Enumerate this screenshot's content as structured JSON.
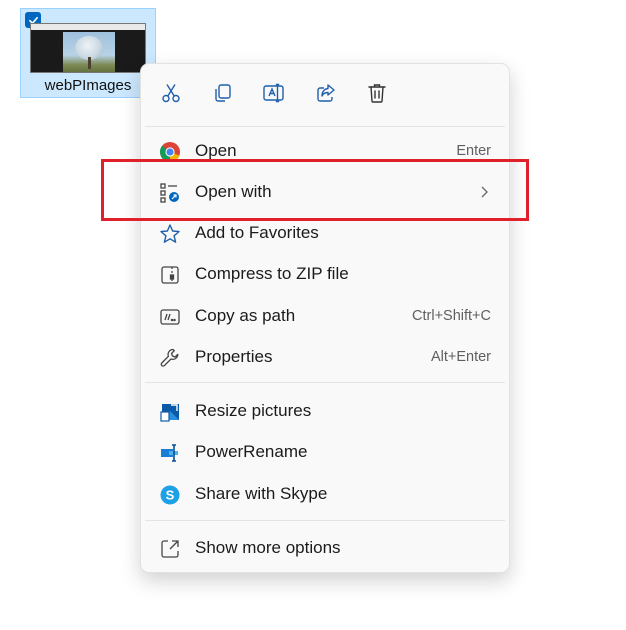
{
  "file": {
    "name": "webPImages",
    "selected": true
  },
  "toolbar": {
    "buttons": [
      {
        "id": "cut",
        "icon": "scissors-icon",
        "tooltip": "Cut"
      },
      {
        "id": "copy",
        "icon": "copy-icon",
        "tooltip": "Copy"
      },
      {
        "id": "rename",
        "icon": "rename-icon",
        "tooltip": "Rename"
      },
      {
        "id": "share",
        "icon": "share-icon",
        "tooltip": "Share"
      },
      {
        "id": "delete",
        "icon": "trash-icon",
        "tooltip": "Delete"
      }
    ]
  },
  "menu": {
    "items": [
      {
        "label": "Open",
        "shortcut": "Enter",
        "icon": "chrome-icon"
      },
      {
        "label": "Open with",
        "shortcut": "",
        "icon": "open-with-icon",
        "submenu": true,
        "highlighted": true
      },
      {
        "label": "Add to Favorites",
        "shortcut": "",
        "icon": "star-icon"
      },
      {
        "label": "Compress to ZIP file",
        "shortcut": "",
        "icon": "zip-icon"
      },
      {
        "label": "Copy as path",
        "shortcut": "Ctrl+Shift+C",
        "icon": "copy-path-icon"
      },
      {
        "label": "Properties",
        "shortcut": "Alt+Enter",
        "icon": "wrench-icon"
      },
      {
        "label": "Resize pictures",
        "shortcut": "",
        "icon": "resize-pictures-icon"
      },
      {
        "label": "PowerRename",
        "shortcut": "",
        "icon": "power-rename-icon"
      },
      {
        "label": "Share with Skype",
        "shortcut": "",
        "icon": "skype-icon"
      },
      {
        "label": "Show more options",
        "shortcut": "",
        "icon": "more-options-icon"
      }
    ]
  },
  "colors": {
    "accent": "#0067c0",
    "highlight_box": "#e0202a",
    "menu_bg": "#f9f9f9",
    "selection_bg": "#cce8ff"
  }
}
